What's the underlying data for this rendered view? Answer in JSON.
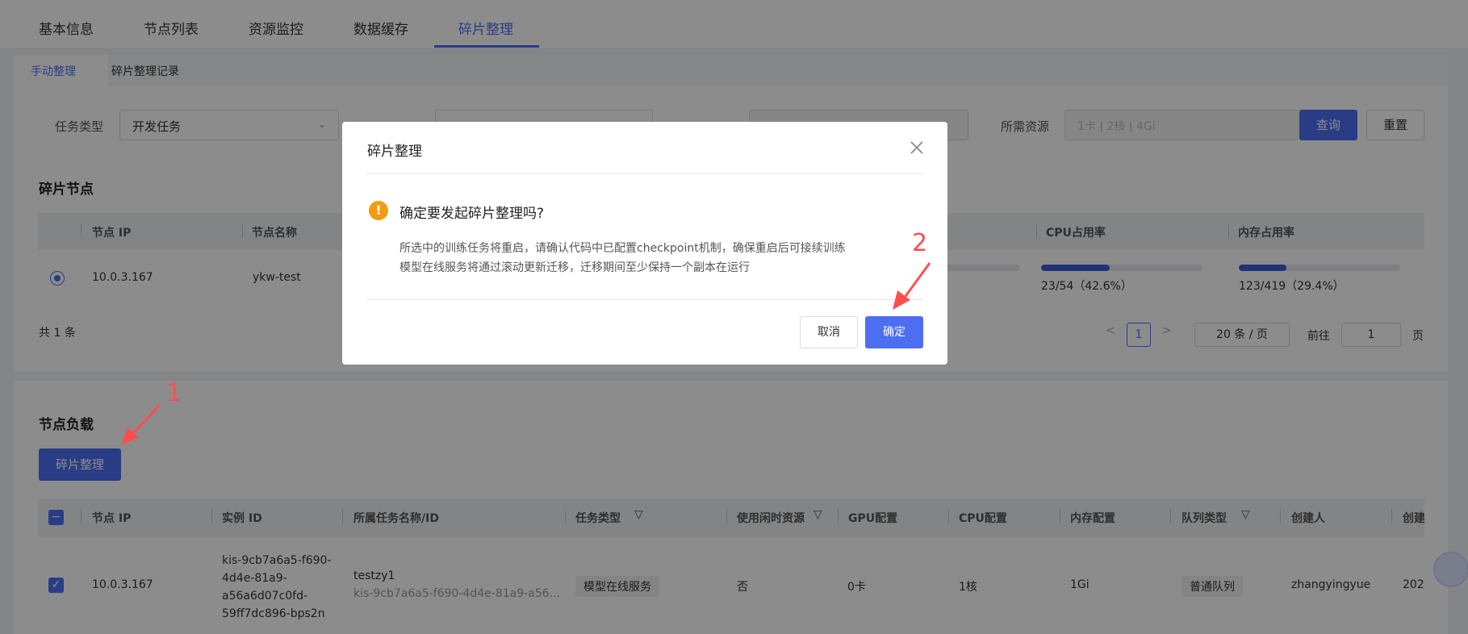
{
  "top_tabs": [
    "基本信息",
    "节点列表",
    "资源监控",
    "数据缓存",
    "碎片整理"
  ],
  "active_top_tab": "碎片整理",
  "sub_tabs": [
    "手动整理",
    "碎片整理记录"
  ],
  "filters": {
    "task_type_label": "任务类型",
    "task_type_value": "开发任务",
    "resource_label": "所需资源",
    "resource_placeholder": "1卡 | 2核 | 4Gi",
    "query_button": "查询",
    "reset_button": "重置"
  },
  "fragment_nodes": {
    "title": "碎片节点",
    "columns": [
      "节点 IP",
      "节点名称",
      "CPU占用率",
      "内存占用率"
    ],
    "row": {
      "ip": "10.0.3.167",
      "name": "ykw-test",
      "cpu_text": "23/54（42.6%）",
      "cpu_ratio": 0.426,
      "mem_text": "123/419（29.4%）",
      "mem_ratio": 0.294
    },
    "total": "共 1 条",
    "pager": {
      "current_page": "1",
      "page_size": "20 条 / 页",
      "goto_label": "前往",
      "goto_value": "1",
      "page_unit": "页"
    }
  },
  "node_load": {
    "title": "节点负载",
    "defrag_button": "碎片整理",
    "columns": [
      "节点 IP",
      "实例 ID",
      "所属任务名称/ID",
      "任务类型",
      "使用闲时资源",
      "GPU配置",
      "CPU配置",
      "内存配置",
      "队列类型",
      "创建人",
      "创建"
    ],
    "row": {
      "ip": "10.0.3.167",
      "instance_id_lines": [
        "kis-9cb7a6a5-f690-",
        "4d4e-81a9-",
        "a56a6d07c0fd-",
        "59ff7dc896-bps2n"
      ],
      "task_name": "testzy1",
      "task_id": "kis-9cb7a6a5-f690-4d4e-81a9-a56...",
      "task_type": "模型在线服务",
      "idle": "否",
      "gpu": "0卡",
      "cpu": "1核",
      "mem": "1Gi",
      "queue": "普通队列",
      "creator": "zhangyingyue",
      "created": "202"
    }
  },
  "dialog": {
    "title": "碎片整理",
    "question": "确定要发起碎片整理吗?",
    "desc_line1": "所选中的训练任务将重启，请确认代码中已配置checkpoint机制，确保重启后可接续训练",
    "desc_line2": "模型在线服务将通过滚动更新迁移，迁移期间至少保持一个副本在运行",
    "cancel": "取消",
    "confirm": "确定"
  },
  "annotations": [
    "1",
    "2"
  ],
  "colors": {
    "primary": "#4e6ef2",
    "warning": "#f39c12",
    "annotation": "#ff4d4f"
  }
}
